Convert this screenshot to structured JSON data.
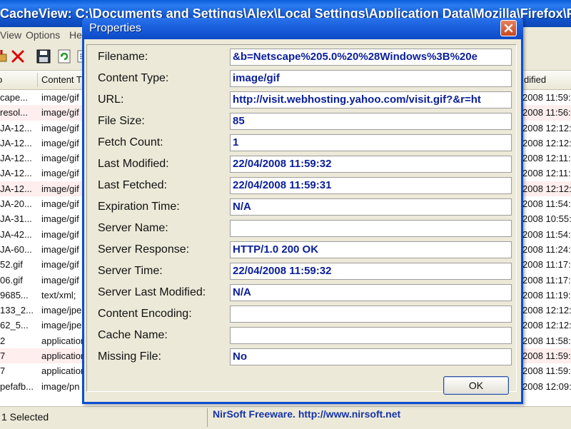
{
  "window": {
    "title": "CacheView:   C:\\Documents and Settings\\Alex\\Local Settings\\Application Data\\Mozilla\\Firefox\\Profiles..."
  },
  "menu": {
    "items": [
      "View",
      "Options",
      "He"
    ]
  },
  "toolbar": {
    "icons": [
      "save-icon",
      "delete-icon",
      "floppy-icon",
      "refresh-icon",
      "properties-icon"
    ]
  },
  "list": {
    "headers": [
      "o",
      "Content T",
      "dified"
    ],
    "rows": [
      {
        "name": "cape...",
        "type": "image/gif",
        "modified": "2008 11:59:"
      },
      {
        "name": "resol...",
        "type": "image/gif",
        "modified": "2008 11:56:"
      },
      {
        "name": "JA-12...",
        "type": "image/gif",
        "modified": "2008 12:12:"
      },
      {
        "name": "JA-12...",
        "type": "image/gif",
        "modified": "2008 12:12:"
      },
      {
        "name": "JA-12...",
        "type": "image/gif",
        "modified": "2008 12:11:"
      },
      {
        "name": "JA-12...",
        "type": "image/gif",
        "modified": "2008 12:11:"
      },
      {
        "name": "JA-12...",
        "type": "image/gif",
        "modified": "2008 12:12:"
      },
      {
        "name": "JA-20...",
        "type": "image/gif",
        "modified": "2008 11:54:"
      },
      {
        "name": "JA-31...",
        "type": "image/gif",
        "modified": "2008 10:55:"
      },
      {
        "name": "JA-42...",
        "type": "image/gif",
        "modified": "2008 11:54:"
      },
      {
        "name": "JA-60...",
        "type": "image/gif",
        "modified": "2008 11:24:"
      },
      {
        "name": "52.gif",
        "type": "image/gif",
        "modified": "2008 11:17:"
      },
      {
        "name": "06.gif",
        "type": "image/gif",
        "modified": "2008 11:17:"
      },
      {
        "name": "9685...",
        "type": "text/xml;",
        "modified": "2008 11:19:"
      },
      {
        "name": "133_2...",
        "type": "image/jpe",
        "modified": "2008 12:12:"
      },
      {
        "name": "62_5...",
        "type": "image/jpe",
        "modified": "2008 12:12:"
      },
      {
        "name": "2",
        "type": "application",
        "modified": "2008 11:58:"
      },
      {
        "name": "7",
        "type": "application",
        "modified": "2008 11:59:"
      },
      {
        "name": "7",
        "type": "application",
        "modified": "2008 11:59:"
      },
      {
        "name": "pefafb...",
        "type": "image/pn",
        "modified": "2008 12:09:"
      }
    ]
  },
  "status": {
    "selected": "1 Selected",
    "credit": "NirSoft Freeware.  http://www.nirsoft.net"
  },
  "dialog": {
    "title": "Properties",
    "fields": [
      {
        "label": "Filename:",
        "value": "&b=Netscape%205.0%20%28Windows%3B%20e"
      },
      {
        "label": "Content Type:",
        "value": "image/gif"
      },
      {
        "label": "URL:",
        "value": "http://visit.webhosting.yahoo.com/visit.gif?&r=ht"
      },
      {
        "label": "File Size:",
        "value": "85"
      },
      {
        "label": "Fetch Count:",
        "value": "1"
      },
      {
        "label": "Last Modified:",
        "value": "22/04/2008 11:59:32"
      },
      {
        "label": "Last Fetched:",
        "value": "22/04/2008 11:59:31"
      },
      {
        "label": "Expiration Time:",
        "value": "N/A"
      },
      {
        "label": "Server Name:",
        "value": ""
      },
      {
        "label": "Server Response:",
        "value": "HTTP/1.0 200 OK"
      },
      {
        "label": "Server Time:",
        "value": "22/04/2008 11:59:32"
      },
      {
        "label": "Server Last Modified:",
        "value": "N/A"
      },
      {
        "label": "Content Encoding:",
        "value": ""
      },
      {
        "label": "Cache Name:",
        "value": ""
      },
      {
        "label": "Missing File:",
        "value": "No"
      }
    ],
    "ok_label": "OK"
  },
  "colors": {
    "titlebar": "#1558d2",
    "dialog_value_text": "#0a1f99",
    "credit_text": "#1533a8",
    "row_highlight": "#ffeeee"
  }
}
